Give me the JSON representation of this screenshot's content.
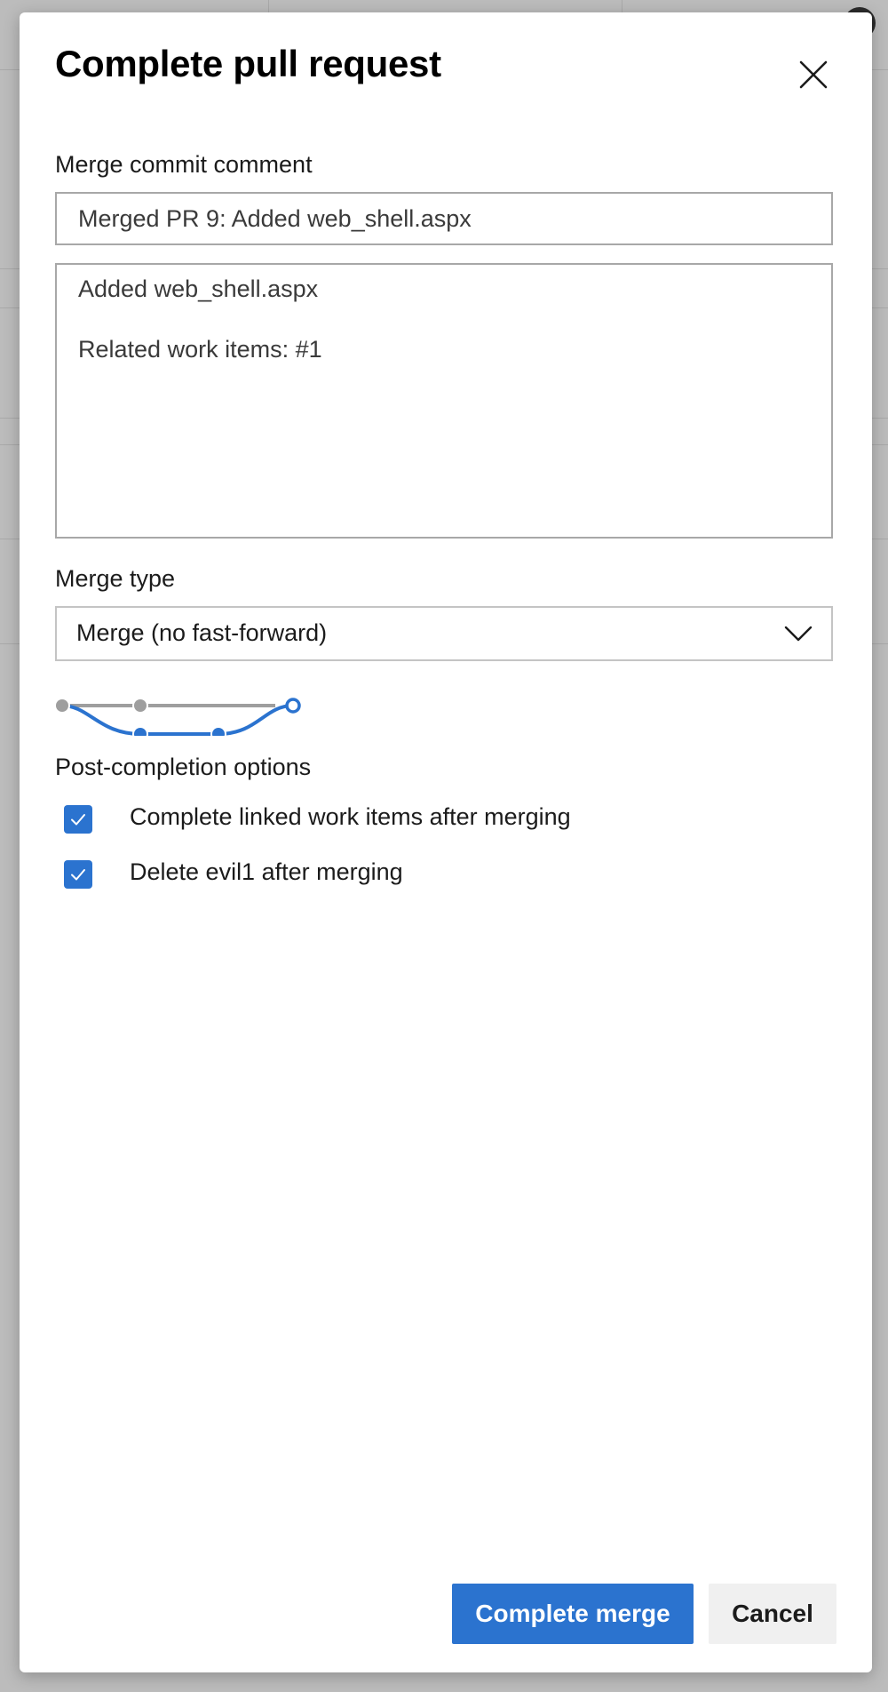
{
  "colors": {
    "accent": "#2b73cf",
    "diagram_gray": "#9e9e9e",
    "overlay": "#bcbcbc"
  },
  "dialog": {
    "title": "Complete pull request",
    "close_icon": "close-icon"
  },
  "merge_commit": {
    "label": "Merge commit comment",
    "title_value": "Merged PR 9: Added web_shell.aspx",
    "description_value": "Added web_shell.aspx\n\nRelated work items: #1"
  },
  "merge_type": {
    "label": "Merge type",
    "selected": "Merge (no fast-forward)",
    "chevron_icon": "chevron-down-icon",
    "diagram_icon": "merge-no-fast-forward-diagram"
  },
  "post_completion": {
    "label": "Post-completion options",
    "options": [
      {
        "label": "Complete linked work items after merging",
        "checked": true
      },
      {
        "label": "Delete evil1 after merging",
        "checked": true
      }
    ]
  },
  "footer": {
    "primary_label": "Complete merge",
    "cancel_label": "Cancel"
  }
}
